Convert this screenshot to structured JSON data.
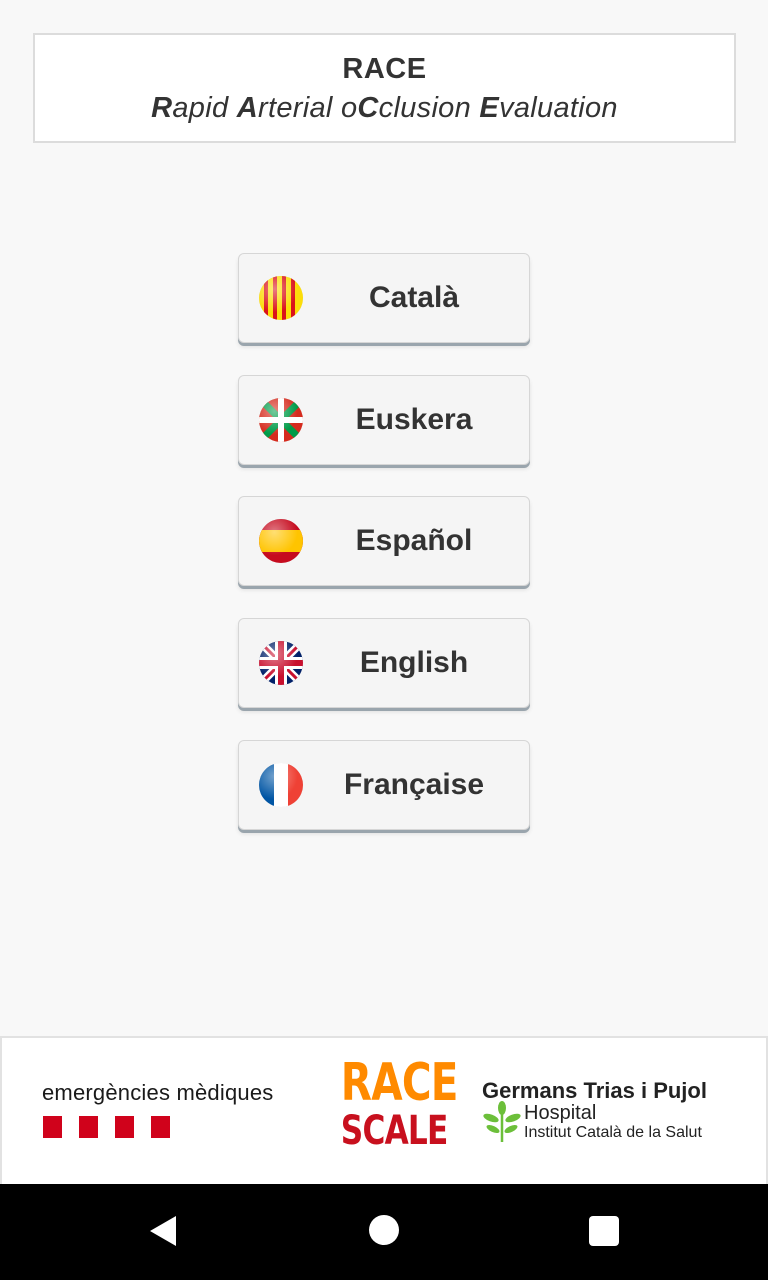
{
  "header": {
    "title": "RACE",
    "subtitle_parts": [
      {
        "text": "R",
        "bold": true
      },
      {
        "text": "apid ",
        "bold": false
      },
      {
        "text": "A",
        "bold": true
      },
      {
        "text": "rterial o",
        "bold": false
      },
      {
        "text": "C",
        "bold": true
      },
      {
        "text": "clusion ",
        "bold": false
      },
      {
        "text": "E",
        "bold": true
      },
      {
        "text": "valuation",
        "bold": false
      }
    ]
  },
  "languages": [
    {
      "label": "Català",
      "flag": "catalonia-flag-icon"
    },
    {
      "label": "Euskera",
      "flag": "basque-flag-icon"
    },
    {
      "label": "Español",
      "flag": "spain-flag-icon"
    },
    {
      "label": "English",
      "flag": "uk-flag-icon"
    },
    {
      "label": "Française",
      "flag": "france-flag-icon"
    }
  ],
  "footer": {
    "sem_text": "emergències mèdiques",
    "race_logo_top": "RACE",
    "race_logo_bottom": "SCALE",
    "hospital_name": "Germans Trias i Pujol",
    "hospital_word": "Hospital",
    "institute": "Institut Català de la Salut"
  },
  "colors": {
    "race_orange": "#ff8a00",
    "race_red": "#c8101e",
    "sem_red": "#d0021b"
  }
}
